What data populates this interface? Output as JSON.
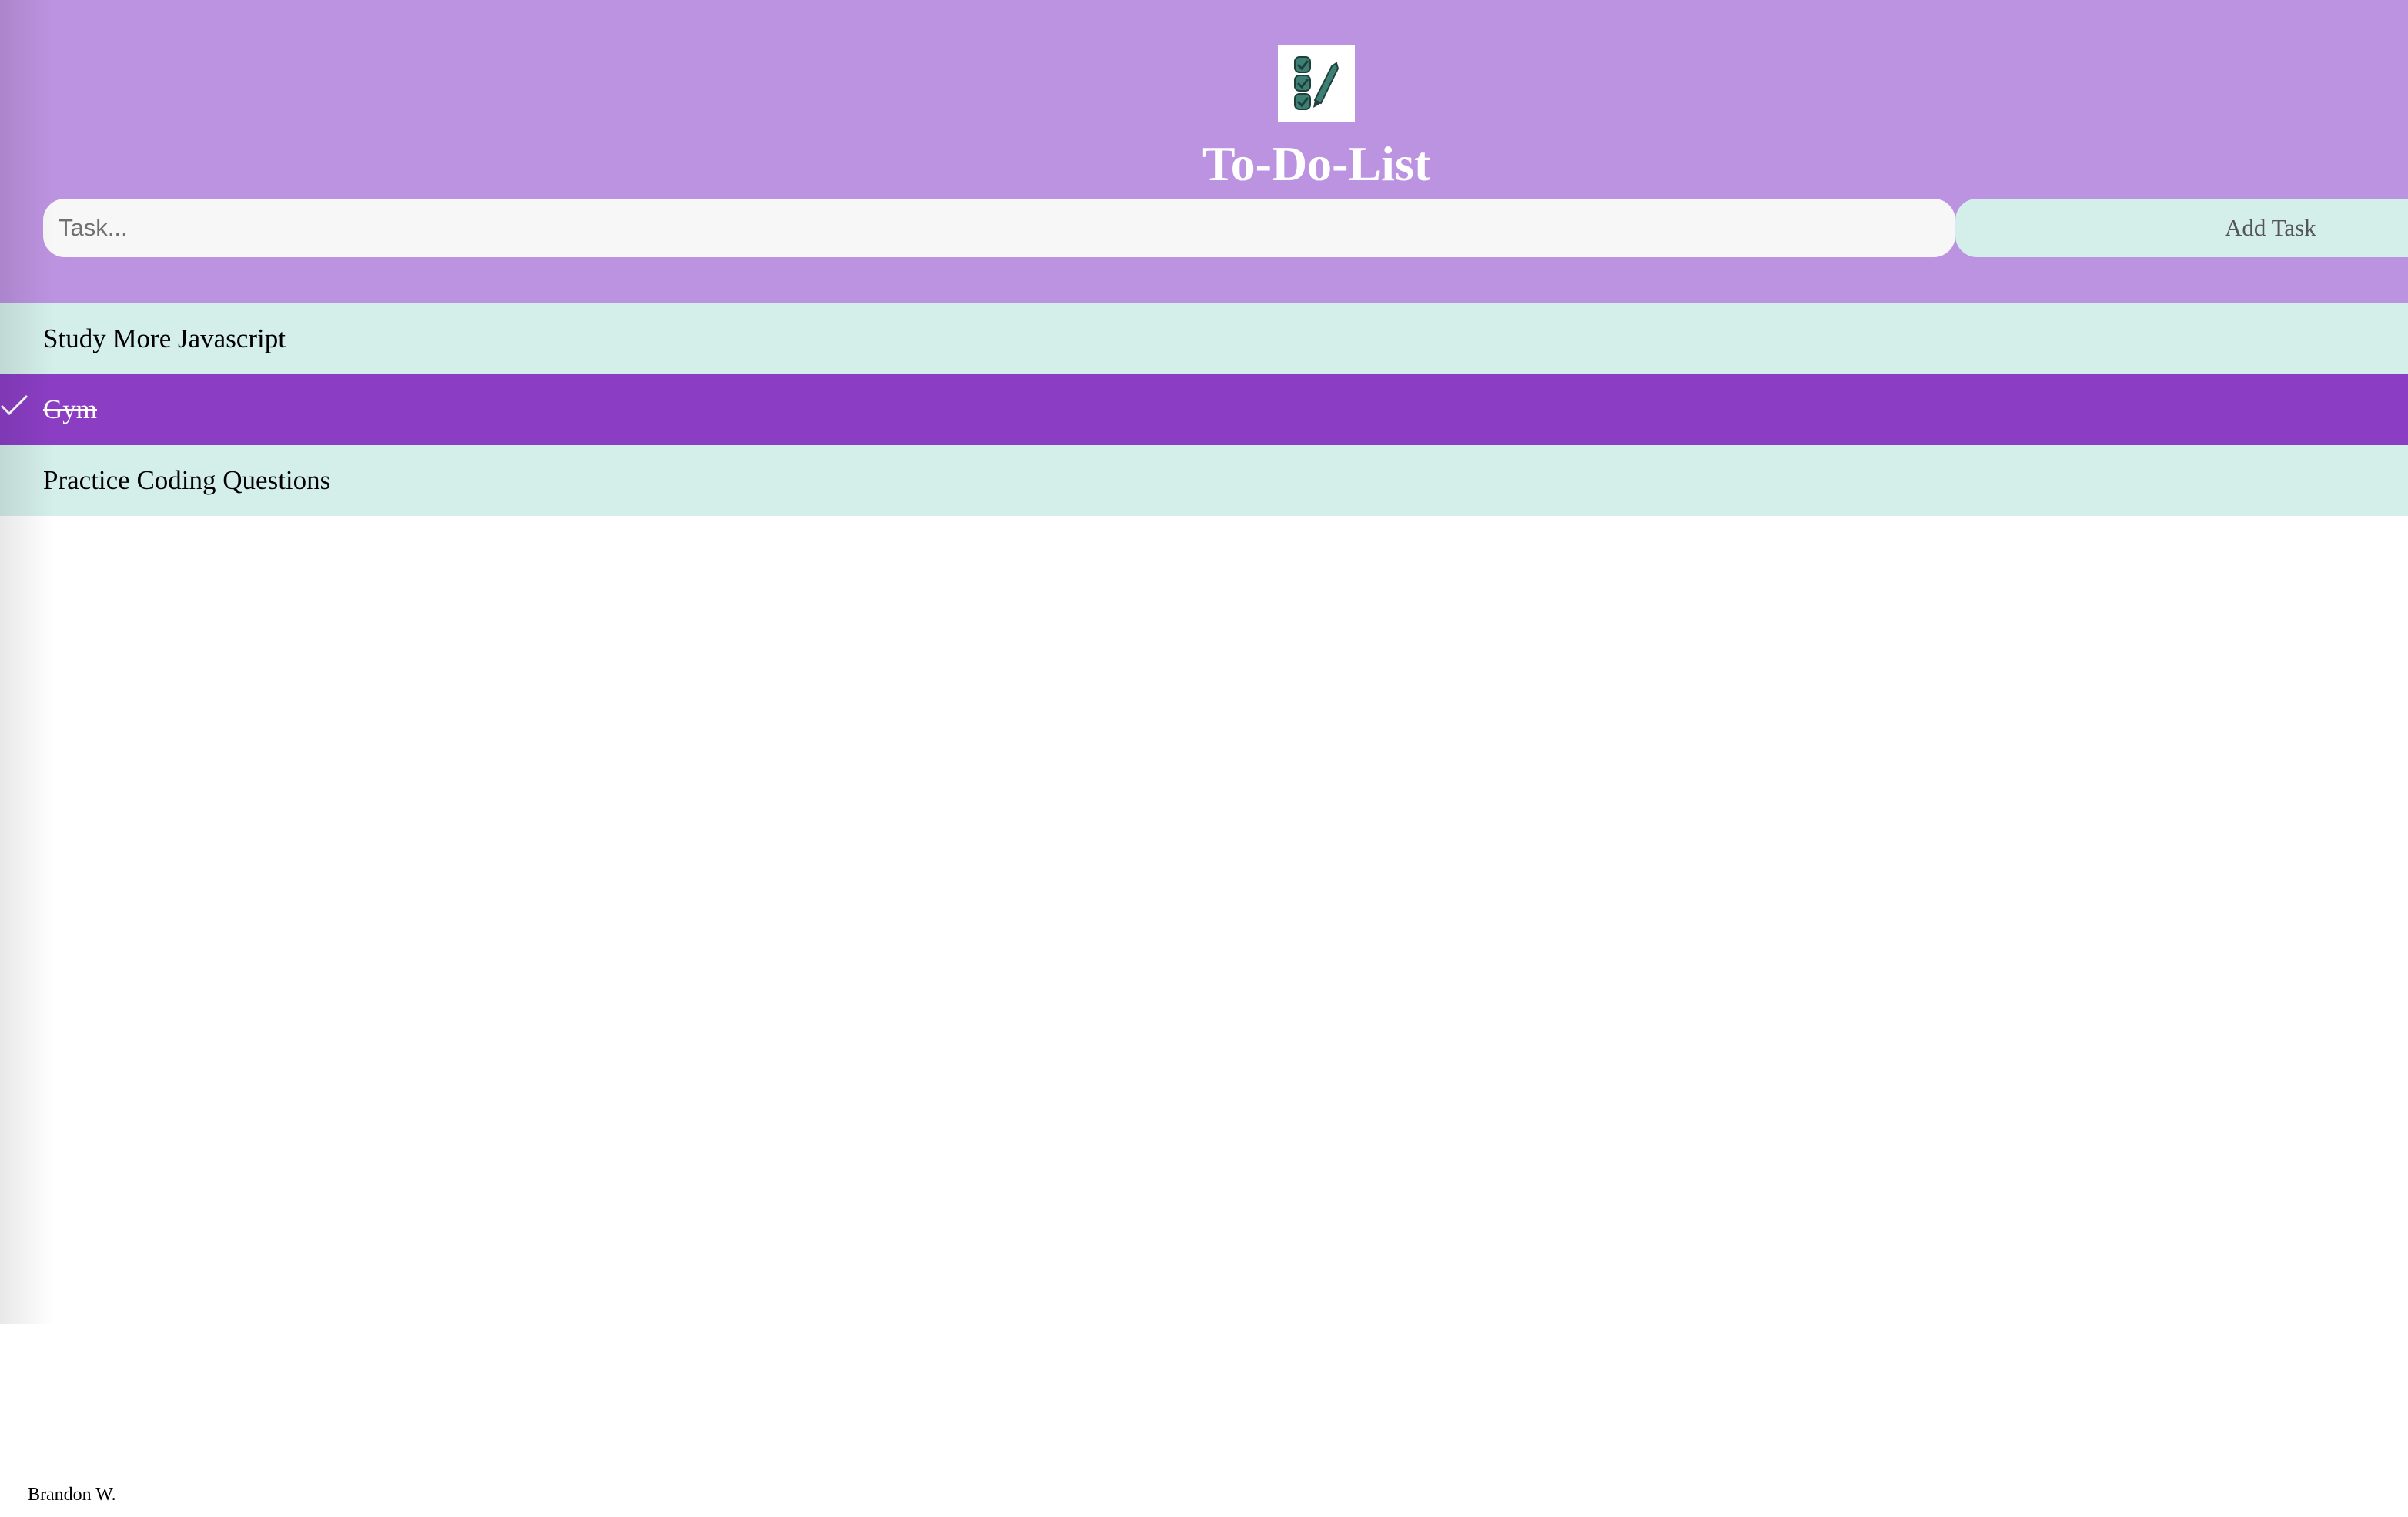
{
  "app": {
    "logo_icon": "checklist-pen-icon",
    "title": "To-Do-List"
  },
  "input": {
    "value": "",
    "placeholder": "Task..."
  },
  "add_button": {
    "label": "Add Task"
  },
  "tasks": [
    {
      "label": "Study More Javascript",
      "checked": false
    },
    {
      "label": "Gym",
      "checked": true
    },
    {
      "label": "Practice Coding Questions",
      "checked": false
    }
  ],
  "footer": {
    "author": "Brandon W."
  },
  "colors": {
    "header_bg": "#bc93e0",
    "task_bg": "#d4eeea",
    "checked_bg": "#8b3ec4",
    "input_bg": "#f7f7f7"
  }
}
